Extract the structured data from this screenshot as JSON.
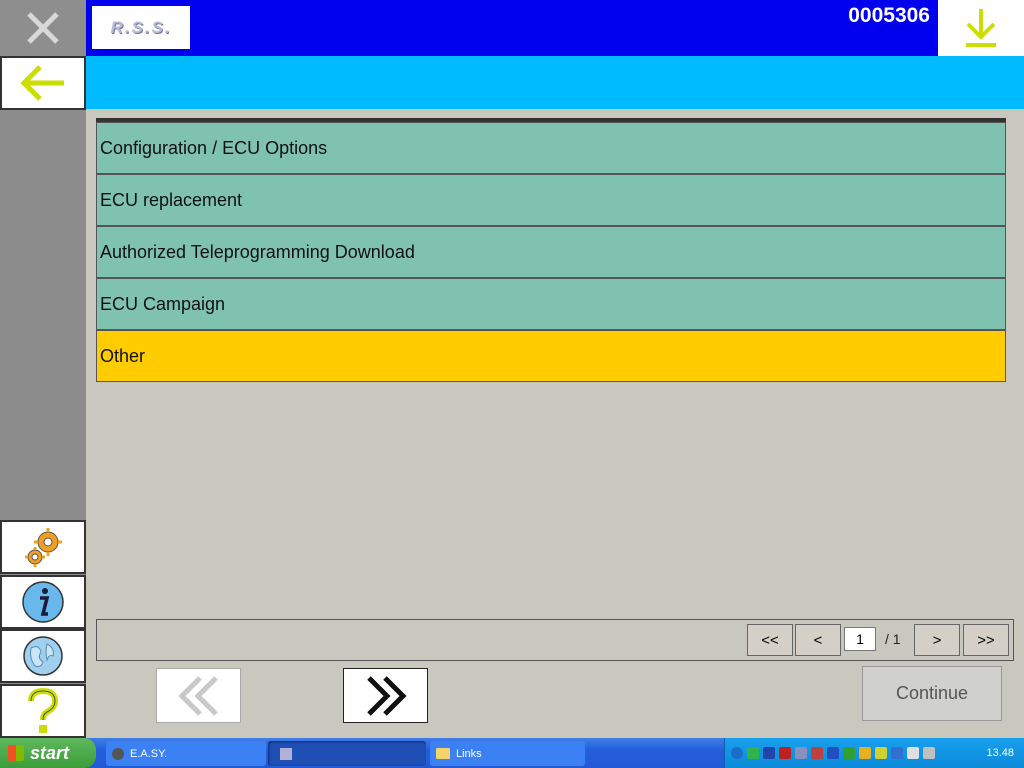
{
  "header": {
    "logo_text": "R.S.S.",
    "vehicle_id": "0005306"
  },
  "list": {
    "items": [
      {
        "label": "Configuration / ECU Options",
        "selected": false
      },
      {
        "label": "ECU replacement",
        "selected": false
      },
      {
        "label": "Authorized Teleprogramming Download",
        "selected": false
      },
      {
        "label": "ECU Campaign",
        "selected": false
      },
      {
        "label": "Other",
        "selected": true
      }
    ]
  },
  "pager": {
    "first_label": "<<",
    "prev_label": "<",
    "current_page": "1",
    "total_label": "/ 1",
    "next_label": ">",
    "last_label": ">>"
  },
  "nav": {
    "continue_label": "Continue"
  },
  "taskbar": {
    "start_label": "start",
    "tasks": [
      {
        "label": "E.A.SY.",
        "icon": "app-icon"
      },
      {
        "label": "",
        "icon": "diag-icon"
      },
      {
        "label": "Links",
        "icon": "folder-icon"
      }
    ],
    "clock": "13.48"
  },
  "colors": {
    "header_blue": "#0000ee",
    "subheader_cyan": "#00bbff",
    "row_green": "#7fc2b0",
    "row_selected": "#ffcc00",
    "icon_yellow": "#ccdd00"
  }
}
